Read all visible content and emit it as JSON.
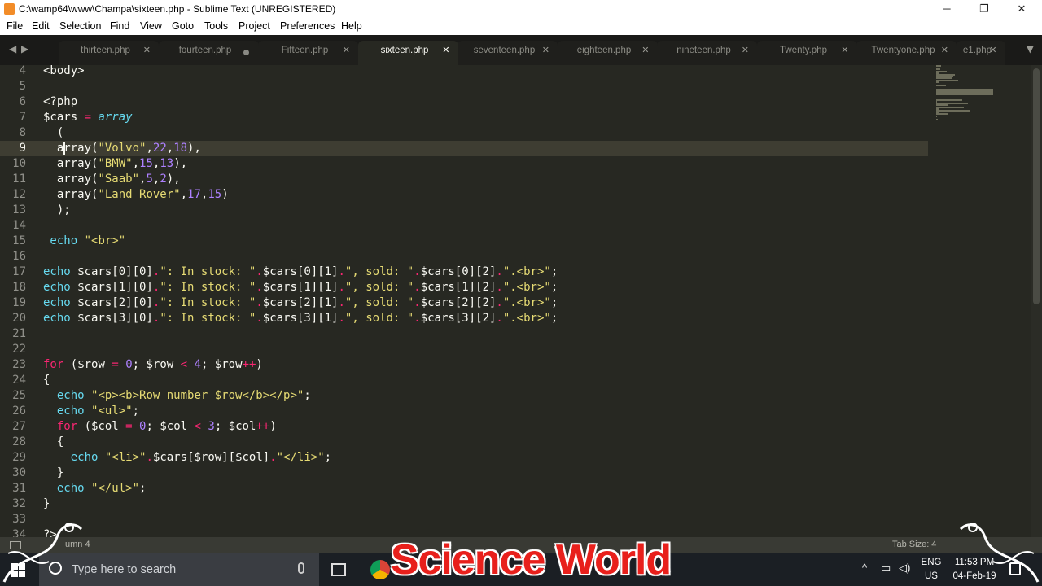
{
  "window": {
    "title": "C:\\wamp64\\www\\Champa\\sixteen.php - Sublime Text (UNREGISTERED)",
    "minimize": "─",
    "maximize": "❐",
    "close": "✕"
  },
  "menu": [
    "File",
    "Edit",
    "Selection",
    "Find",
    "View",
    "Goto",
    "Tools",
    "Project",
    "Preferences",
    "Help"
  ],
  "tabs": [
    {
      "label": "thirteen.php",
      "state": "close"
    },
    {
      "label": "fourteen.php",
      "state": "dirty"
    },
    {
      "label": "Fifteen.php",
      "state": "close"
    },
    {
      "label": "sixteen.php",
      "state": "active"
    },
    {
      "label": "seventeen.php",
      "state": "close"
    },
    {
      "label": "eighteen.php",
      "state": "close"
    },
    {
      "label": "nineteen.php",
      "state": "close"
    },
    {
      "label": "Twenty.php",
      "state": "close"
    },
    {
      "label": "Twentyone.php",
      "state": "close"
    },
    {
      "label": "e1.php",
      "state": "close"
    }
  ],
  "tab_nav": {
    "prev": "◀",
    "next": "▶",
    "dropdown": "▼"
  },
  "editor": {
    "current_line": 9,
    "lines": [
      {
        "n": "4",
        "tokens": [
          [
            "t",
            "<body>"
          ]
        ]
      },
      {
        "n": "5",
        "tokens": []
      },
      {
        "n": "6",
        "tokens": [
          [
            "t",
            "<?php"
          ]
        ]
      },
      {
        "n": "7",
        "tokens": [
          [
            "t",
            "$cars "
          ],
          [
            "k",
            "="
          ],
          [
            "t",
            " "
          ],
          [
            "i",
            "array"
          ]
        ]
      },
      {
        "n": "8",
        "tokens": [
          [
            "t",
            "  ("
          ]
        ]
      },
      {
        "n": "9",
        "tokens": [
          [
            "t",
            "  array("
          ],
          [
            "s",
            "\"Volvo\""
          ],
          [
            "t",
            ","
          ],
          [
            "n",
            "22"
          ],
          [
            "t",
            ","
          ],
          [
            "n",
            "18"
          ],
          [
            "t",
            "),"
          ]
        ]
      },
      {
        "n": "10",
        "tokens": [
          [
            "t",
            "  array("
          ],
          [
            "s",
            "\"BMW\""
          ],
          [
            "t",
            ","
          ],
          [
            "n",
            "15"
          ],
          [
            "t",
            ","
          ],
          [
            "n",
            "13"
          ],
          [
            "t",
            "),"
          ]
        ]
      },
      {
        "n": "11",
        "tokens": [
          [
            "t",
            "  array("
          ],
          [
            "s",
            "\"Saab\""
          ],
          [
            "t",
            ","
          ],
          [
            "n",
            "5"
          ],
          [
            "t",
            ","
          ],
          [
            "n",
            "2"
          ],
          [
            "t",
            "),"
          ]
        ]
      },
      {
        "n": "12",
        "tokens": [
          [
            "t",
            "  array("
          ],
          [
            "s",
            "\"Land Rover\""
          ],
          [
            "t",
            ","
          ],
          [
            "n",
            "17"
          ],
          [
            "t",
            ","
          ],
          [
            "n",
            "15"
          ],
          [
            "t",
            ")"
          ]
        ]
      },
      {
        "n": "13",
        "tokens": [
          [
            "t",
            "  );"
          ]
        ]
      },
      {
        "n": "14",
        "tokens": []
      },
      {
        "n": "15",
        "tokens": [
          [
            "f",
            " echo"
          ],
          [
            "t",
            " "
          ],
          [
            "s",
            "\"<br>\""
          ]
        ]
      },
      {
        "n": "16",
        "tokens": []
      },
      {
        "n": "17",
        "tokens": [
          [
            "f",
            "echo"
          ],
          [
            "t",
            " $cars[0][0]"
          ],
          [
            "k",
            "."
          ],
          [
            "s",
            "\": In stock: \""
          ],
          [
            "k",
            "."
          ],
          [
            "t",
            "$cars[0][1]"
          ],
          [
            "k",
            "."
          ],
          [
            "s",
            "\", sold: \""
          ],
          [
            "k",
            "."
          ],
          [
            "t",
            "$cars[0][2]"
          ],
          [
            "k",
            "."
          ],
          [
            "s",
            "\".<br>\""
          ],
          [
            "t",
            ";"
          ]
        ]
      },
      {
        "n": "18",
        "tokens": [
          [
            "f",
            "echo"
          ],
          [
            "t",
            " $cars[1][0]"
          ],
          [
            "k",
            "."
          ],
          [
            "s",
            "\": In stock: \""
          ],
          [
            "k",
            "."
          ],
          [
            "t",
            "$cars[1][1]"
          ],
          [
            "k",
            "."
          ],
          [
            "s",
            "\", sold: \""
          ],
          [
            "k",
            "."
          ],
          [
            "t",
            "$cars[1][2]"
          ],
          [
            "k",
            "."
          ],
          [
            "s",
            "\".<br>\""
          ],
          [
            "t",
            ";"
          ]
        ]
      },
      {
        "n": "19",
        "tokens": [
          [
            "f",
            "echo"
          ],
          [
            "t",
            " $cars[2][0]"
          ],
          [
            "k",
            "."
          ],
          [
            "s",
            "\": In stock: \""
          ],
          [
            "k",
            "."
          ],
          [
            "t",
            "$cars[2][1]"
          ],
          [
            "k",
            "."
          ],
          [
            "s",
            "\", sold: \""
          ],
          [
            "k",
            "."
          ],
          [
            "t",
            "$cars[2][2]"
          ],
          [
            "k",
            "."
          ],
          [
            "s",
            "\".<br>\""
          ],
          [
            "t",
            ";"
          ]
        ]
      },
      {
        "n": "20",
        "tokens": [
          [
            "f",
            "echo"
          ],
          [
            "t",
            " $cars[3][0]"
          ],
          [
            "k",
            "."
          ],
          [
            "s",
            "\": In stock: \""
          ],
          [
            "k",
            "."
          ],
          [
            "t",
            "$cars[3][1]"
          ],
          [
            "k",
            "."
          ],
          [
            "s",
            "\", sold: \""
          ],
          [
            "k",
            "."
          ],
          [
            "t",
            "$cars[3][2]"
          ],
          [
            "k",
            "."
          ],
          [
            "s",
            "\".<br>\""
          ],
          [
            "t",
            ";"
          ]
        ]
      },
      {
        "n": "21",
        "tokens": []
      },
      {
        "n": "22",
        "tokens": []
      },
      {
        "n": "23",
        "tokens": [
          [
            "k",
            "for"
          ],
          [
            "t",
            " ($row "
          ],
          [
            "k",
            "="
          ],
          [
            "t",
            " "
          ],
          [
            "n",
            "0"
          ],
          [
            "t",
            "; $row "
          ],
          [
            "k",
            "<"
          ],
          [
            "t",
            " "
          ],
          [
            "n",
            "4"
          ],
          [
            "t",
            "; $row"
          ],
          [
            "k",
            "++"
          ],
          [
            "t",
            ")"
          ]
        ]
      },
      {
        "n": "24",
        "tokens": [
          [
            "t",
            "{"
          ]
        ]
      },
      {
        "n": "25",
        "tokens": [
          [
            "f",
            "  echo"
          ],
          [
            "t",
            " "
          ],
          [
            "s",
            "\"<p><b>Row number $row</b></p>\""
          ],
          [
            "t",
            ";"
          ]
        ]
      },
      {
        "n": "26",
        "tokens": [
          [
            "f",
            "  echo"
          ],
          [
            "t",
            " "
          ],
          [
            "s",
            "\"<ul>\""
          ],
          [
            "t",
            ";"
          ]
        ]
      },
      {
        "n": "27",
        "tokens": [
          [
            "k",
            "  for"
          ],
          [
            "t",
            " ($col "
          ],
          [
            "k",
            "="
          ],
          [
            "t",
            " "
          ],
          [
            "n",
            "0"
          ],
          [
            "t",
            "; $col "
          ],
          [
            "k",
            "<"
          ],
          [
            "t",
            " "
          ],
          [
            "n",
            "3"
          ],
          [
            "t",
            "; $col"
          ],
          [
            "k",
            "++"
          ],
          [
            "t",
            ")"
          ]
        ]
      },
      {
        "n": "28",
        "tokens": [
          [
            "t",
            "  {"
          ]
        ]
      },
      {
        "n": "29",
        "tokens": [
          [
            "f",
            "    echo"
          ],
          [
            "t",
            " "
          ],
          [
            "s",
            "\"<li>\""
          ],
          [
            "k",
            "."
          ],
          [
            "t",
            "$cars[$row][$col]"
          ],
          [
            "k",
            "."
          ],
          [
            "s",
            "\"</li>\""
          ],
          [
            "t",
            ";"
          ]
        ]
      },
      {
        "n": "30",
        "tokens": [
          [
            "t",
            "  }"
          ]
        ]
      },
      {
        "n": "31",
        "tokens": [
          [
            "f",
            "  echo"
          ],
          [
            "t",
            " "
          ],
          [
            "s",
            "\"</ul>\""
          ],
          [
            "t",
            ";"
          ]
        ]
      },
      {
        "n": "32",
        "tokens": [
          [
            "t",
            "}"
          ]
        ]
      },
      {
        "n": "33",
        "tokens": []
      },
      {
        "n": "34",
        "tokens": [
          [
            "t",
            "?>"
          ]
        ]
      }
    ]
  },
  "status": {
    "position": "umn 4",
    "tab_size": "Tab Size: 4"
  },
  "taskbar": {
    "search_placeholder": "Type here to search",
    "lang_top": "ENG",
    "lang_bottom": "US",
    "time": "11:53 PM",
    "date": "04-Feb-19"
  },
  "watermark": "Science World",
  "colors": {
    "keyword": "#f92672",
    "string": "#e6db74",
    "number": "#ae81ff",
    "function": "#66d9ef",
    "text": "#f8f8f2",
    "background": "#272822"
  }
}
